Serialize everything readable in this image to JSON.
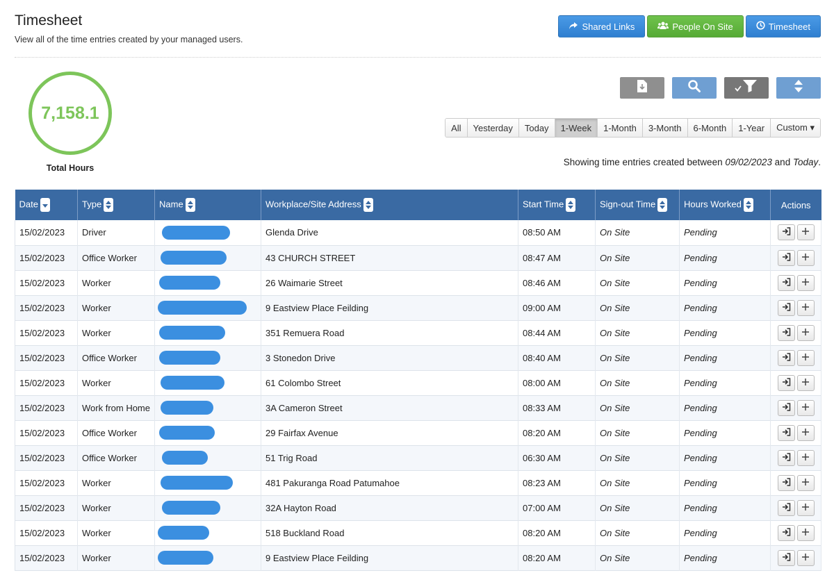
{
  "header": {
    "title": "Timesheet",
    "subtitle": "View all of the time entries created by your managed users."
  },
  "top_buttons": [
    {
      "label": "Shared Links",
      "icon": "share-icon",
      "color": "#2f7fd0"
    },
    {
      "label": "People On Site",
      "icon": "people-icon",
      "color": "#56aa35"
    },
    {
      "label": "Timesheet",
      "icon": "clock-icon",
      "color": "#2f7fd0"
    }
  ],
  "summary": {
    "total_hours": "7,158.1",
    "total_label": "Total Hours",
    "ring_color": "#7dc55a"
  },
  "tools": [
    {
      "icon": "export-icon"
    },
    {
      "icon": "search-icon"
    },
    {
      "icon": "filter-icon"
    },
    {
      "icon": "sort-toggle-icon"
    }
  ],
  "ranges": [
    {
      "label": "All",
      "active": false
    },
    {
      "label": "Yesterday",
      "active": false
    },
    {
      "label": "Today",
      "active": false
    },
    {
      "label": "1-Week",
      "active": true
    },
    {
      "label": "1-Month",
      "active": false
    },
    {
      "label": "3-Month",
      "active": false
    },
    {
      "label": "6-Month",
      "active": false
    },
    {
      "label": "1-Year",
      "active": false
    },
    {
      "label": "Custom ▾",
      "active": false
    }
  ],
  "showing": {
    "prefix": "Showing time entries created between ",
    "from": "09/02/2023",
    "middle": " and ",
    "to": "Today",
    "suffix": "."
  },
  "table": {
    "header_color": "#3a6aa3",
    "columns": [
      "Date",
      "Type",
      "Name",
      "Workplace/Site Address",
      "Start Time",
      "Sign-out Time",
      "Hours Worked",
      "Actions"
    ],
    "rows": [
      {
        "date": "15/02/2023",
        "type": "Driver",
        "address": "Glenda Drive",
        "start": "08:50 AM",
        "signout": "On Site",
        "hours": "Pending"
      },
      {
        "date": "15/02/2023",
        "type": "Office Worker",
        "address": "43 CHURCH STREET",
        "start": "08:47 AM",
        "signout": "On Site",
        "hours": "Pending"
      },
      {
        "date": "15/02/2023",
        "type": "Worker",
        "address": "26 Waimarie Street",
        "start": "08:46 AM",
        "signout": "On Site",
        "hours": "Pending"
      },
      {
        "date": "15/02/2023",
        "type": "Worker",
        "address": "9 Eastview Place Feilding",
        "start": "09:00 AM",
        "signout": "On Site",
        "hours": "Pending"
      },
      {
        "date": "15/02/2023",
        "type": "Worker",
        "address": "351 Remuera Road",
        "start": "08:44 AM",
        "signout": "On Site",
        "hours": "Pending"
      },
      {
        "date": "15/02/2023",
        "type": "Office Worker",
        "address": "3 Stonedon Drive",
        "start": "08:40 AM",
        "signout": "On Site",
        "hours": "Pending"
      },
      {
        "date": "15/02/2023",
        "type": "Worker",
        "address": "61 Colombo Street",
        "start": "08:00 AM",
        "signout": "On Site",
        "hours": "Pending"
      },
      {
        "date": "15/02/2023",
        "type": "Work from Home",
        "address": "3A Cameron Street",
        "start": "08:33 AM",
        "signout": "On Site",
        "hours": "Pending"
      },
      {
        "date": "15/02/2023",
        "type": "Office Worker",
        "address": "29 Fairfax Avenue",
        "start": "08:20 AM",
        "signout": "On Site",
        "hours": "Pending"
      },
      {
        "date": "15/02/2023",
        "type": "Office Worker",
        "address": "51 Trig Road",
        "start": "06:30 AM",
        "signout": "On Site",
        "hours": "Pending"
      },
      {
        "date": "15/02/2023",
        "type": "Worker",
        "address": "481 Pakuranga Road Patumahoe",
        "start": "08:23 AM",
        "signout": "On Site",
        "hours": "Pending"
      },
      {
        "date": "15/02/2023",
        "type": "Worker",
        "address": "32A Hayton Road",
        "start": "07:00 AM",
        "signout": "On Site",
        "hours": "Pending"
      },
      {
        "date": "15/02/2023",
        "type": "Worker",
        "address": "518 Buckland Road",
        "start": "08:20 AM",
        "signout": "On Site",
        "hours": "Pending"
      },
      {
        "date": "15/02/2023",
        "type": "Worker",
        "address": "9 Eastview Place Feilding",
        "start": "08:20 AM",
        "signout": "On Site",
        "hours": "Pending"
      }
    ]
  }
}
